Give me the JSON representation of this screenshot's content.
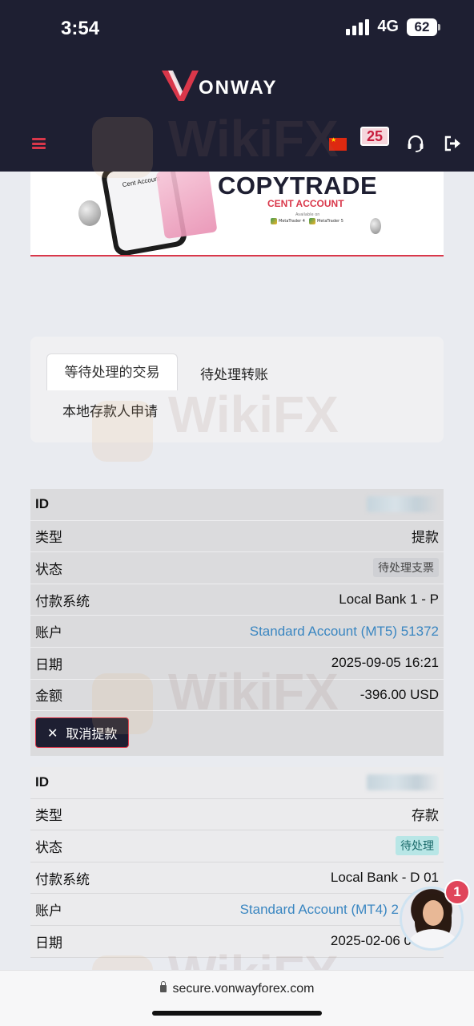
{
  "status_bar": {
    "time": "3:54",
    "network": "4G",
    "battery": "62"
  },
  "header": {
    "brand": "ONWAY",
    "notification_count": "25"
  },
  "banner": {
    "title": "COPYTRADE",
    "subtitle": "CENT ACCOUNT",
    "available": "Available on",
    "platform1": "MetaTrader 4",
    "platform2": "MetaTrader 5",
    "phone_text": "Cent Account"
  },
  "tabs": [
    {
      "label": "等待处理的交易",
      "active": true
    },
    {
      "label": "待处理转账",
      "active": false
    },
    {
      "label": "本地存款人申请",
      "active": false
    }
  ],
  "records": [
    {
      "id_label": "ID",
      "rows": [
        {
          "label": "类型",
          "value": "提款"
        },
        {
          "label": "状态",
          "value": "待处理支票"
        },
        {
          "label": "付款系统",
          "value": "Local Bank 1 - P"
        },
        {
          "label": "账户",
          "value": "Standard Account (MT5) 51372"
        },
        {
          "label": "日期",
          "value": "2025-09-05 16:21"
        },
        {
          "label": "金额",
          "value": "-396.00 USD"
        }
      ],
      "cancel_label": "取消提款"
    },
    {
      "id_label": "ID",
      "rows": [
        {
          "label": "类型",
          "value": "存款"
        },
        {
          "label": "状态",
          "value": "待处理"
        },
        {
          "label": "付款系统",
          "value": "Local Bank - D 01"
        },
        {
          "label": "账户",
          "value": "Standard Account (MT4) 2"
        },
        {
          "label": "日期",
          "value": "2025-02-06 0"
        }
      ]
    }
  ],
  "chat": {
    "unread": "1"
  },
  "browser": {
    "url": "secure.vonwayforex.com"
  },
  "watermark": "WikiFX",
  "colors": {
    "header_bg": "#1e1f32",
    "accent": "#d9374a",
    "link": "#3a86c1"
  }
}
